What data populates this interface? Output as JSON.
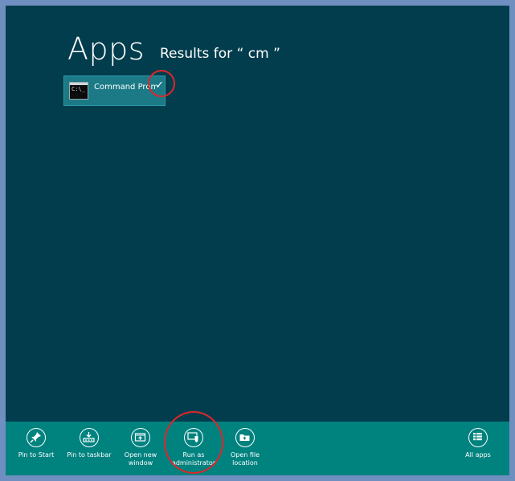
{
  "screen": {
    "title": "Apps",
    "results": "Results for “ cm ”"
  },
  "result_tile": {
    "label": "Command Prompt",
    "selected": true,
    "icon": "command-prompt-icon"
  },
  "appbar": {
    "commands": [
      {
        "label": "Pin to Start",
        "icon": "pin-icon"
      },
      {
        "label": "Pin to taskbar",
        "icon": "taskbar-icon"
      },
      {
        "label": "Open new\nwindow",
        "icon": "new-window-icon"
      },
      {
        "label": "Run as\nadministrator",
        "icon": "shield-icon"
      },
      {
        "label": "Open file\nlocation",
        "icon": "folder-icon"
      }
    ],
    "all_apps": {
      "label": "All apps",
      "icon": "all-apps-icon"
    }
  },
  "colors": {
    "background": "#023d4d",
    "appbar": "#00827f",
    "tile": "#1b7a86",
    "highlight": "#e0262a"
  }
}
